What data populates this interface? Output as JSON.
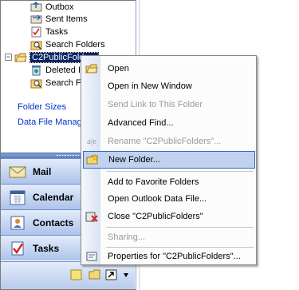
{
  "tree": {
    "items": [
      {
        "label": "Outbox",
        "icon": "outbox-icon"
      },
      {
        "label": "Sent Items",
        "icon": "sent-items-icon"
      },
      {
        "label": "Tasks",
        "icon": "tasks-icon"
      },
      {
        "label": "Search Folders",
        "icon": "search-folders-icon"
      },
      {
        "label": "C2PublicFolders",
        "icon": "pst-folder-icon",
        "expander": "−"
      },
      {
        "label": "Deleted I",
        "icon": "deleted-items-icon"
      },
      {
        "label": "Search Fo",
        "icon": "search-folders-icon"
      }
    ]
  },
  "links": {
    "folder_sizes": "Folder Sizes",
    "data_file_manager": "Data File Manage"
  },
  "nav": {
    "mail": "Mail",
    "calendar": "Calendar",
    "contacts": "Contacts",
    "tasks": "Tasks"
  },
  "menu": {
    "open": "Open",
    "open_new_window": "Open in New Window",
    "send_link": "Send Link to This Folder",
    "advanced_find": "Advanced Find...",
    "rename": "Rename \"C2PublicFolders\"...",
    "new_folder": "New Folder...",
    "add_favorite": "Add to Favorite Folders",
    "open_data_file": "Open Outlook Data File...",
    "close": "Close \"C2PublicFolders\"",
    "sharing": "Sharing...",
    "properties": "Properties for \"C2PublicFolders\"..."
  },
  "colors": {
    "selection": "#0a246a",
    "menu_highlight": "#c1d2ee",
    "link": "#0033cc"
  }
}
